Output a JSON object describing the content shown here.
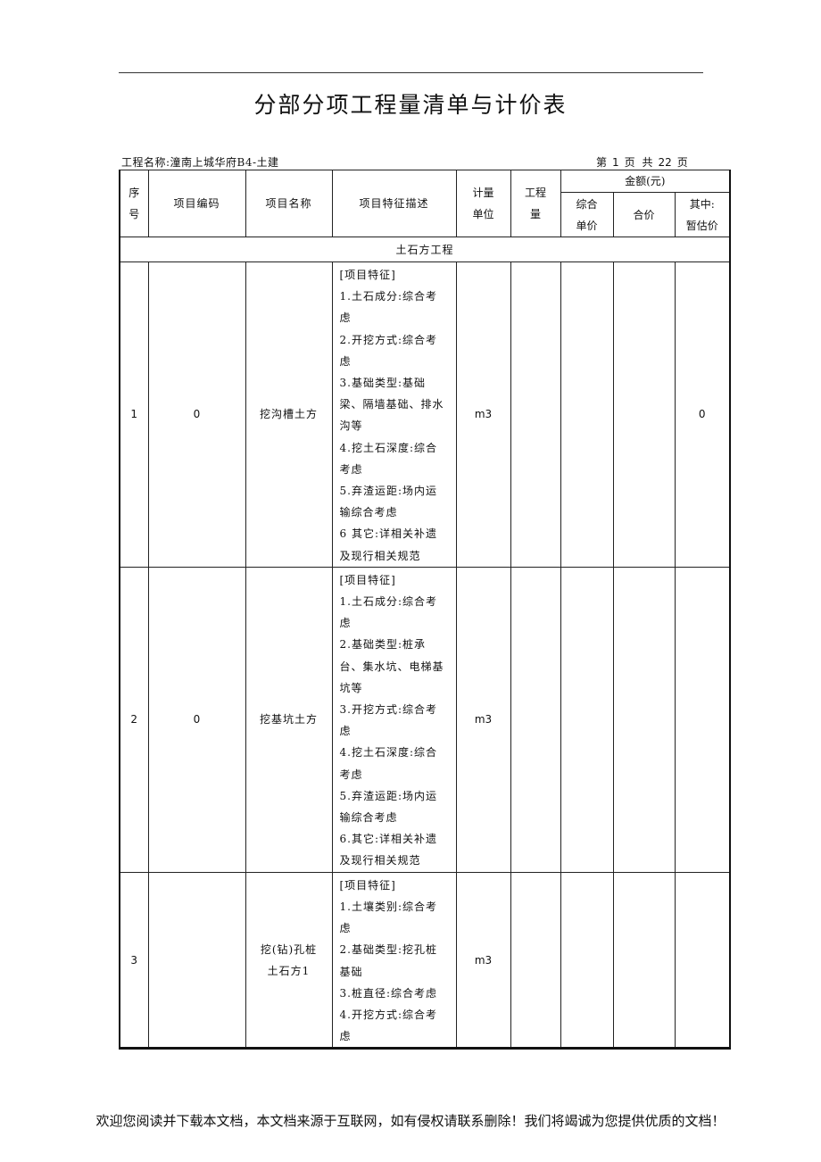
{
  "title": "分部分项工程量清单与计价表",
  "project": {
    "label": "工程名称:潼南上城华府B4-土建",
    "page_prefix": "第",
    "page_current": "1",
    "page_mid": "页 共",
    "page_total": "22",
    "page_suffix": "页"
  },
  "table": {
    "headers": {
      "seq": "序号",
      "seq_line1": "序",
      "seq_line2": "号",
      "code": "项目编码",
      "name": "项目名称",
      "desc": "项目特征描述",
      "unit_line1": "计量",
      "unit_line2": "单位",
      "qty_line1": "工程",
      "qty_line2": "量",
      "amount_group": "金额(元)",
      "unit_price_line1": "综合",
      "unit_price_line2": "单价",
      "total": "合价",
      "provisional_line1": "其中:",
      "provisional_line2": "暂估价"
    },
    "section": "土石方工程",
    "rows": [
      {
        "seq": "1",
        "code": "0",
        "name_lines": [
          "挖沟槽土方"
        ],
        "desc_lines": [
          "[项目特征]",
          "1.土石成分:综合考",
          "虑",
          "2.开挖方式:综合考",
          "虑",
          "3.基础类型:基础",
          "梁、隔墙基础、排水",
          "沟等",
          "4.挖土石深度:综合",
          "考虑",
          "5.弃渣运距:场内运",
          "输综合考虑",
          "6 其它:详相关补遗",
          "及现行相关规范"
        ],
        "unit": "m3",
        "qty": "",
        "unit_price": "",
        "total": "",
        "provisional": "0"
      },
      {
        "seq": "2",
        "code": "0",
        "name_lines": [
          "挖基坑土方"
        ],
        "desc_lines": [
          "[项目特征]",
          "1.土石成分:综合考",
          "虑",
          "2.基础类型:桩承",
          "台、集水坑、电梯基",
          "坑等",
          "3.开挖方式:综合考",
          "虑",
          "4.挖土石深度:综合",
          "考虑",
          "5.弃渣运距:场内运",
          "输综合考虑",
          "6.其它:详相关补遗",
          "及现行相关规范"
        ],
        "unit": "m3",
        "qty": "",
        "unit_price": "",
        "total": "",
        "provisional": ""
      },
      {
        "seq": "3",
        "code": "",
        "name_lines": [
          "挖(钻)孔桩",
          "土石方1"
        ],
        "desc_lines": [
          "[项目特征]",
          "1.土壤类别:综合考",
          "虑",
          "2.基础类型:挖孔桩",
          "基础",
          "3.桩直径:综合考虑",
          "4.开挖方式:综合考",
          "虑"
        ],
        "unit": "m3",
        "qty": "",
        "unit_price": "",
        "total": "",
        "provisional": ""
      }
    ]
  },
  "footer": "欢迎您阅读并下载本文档，本文档来源于互联网，如有侵权请联系删除！我们将竭诚为您提供优质的文档！"
}
